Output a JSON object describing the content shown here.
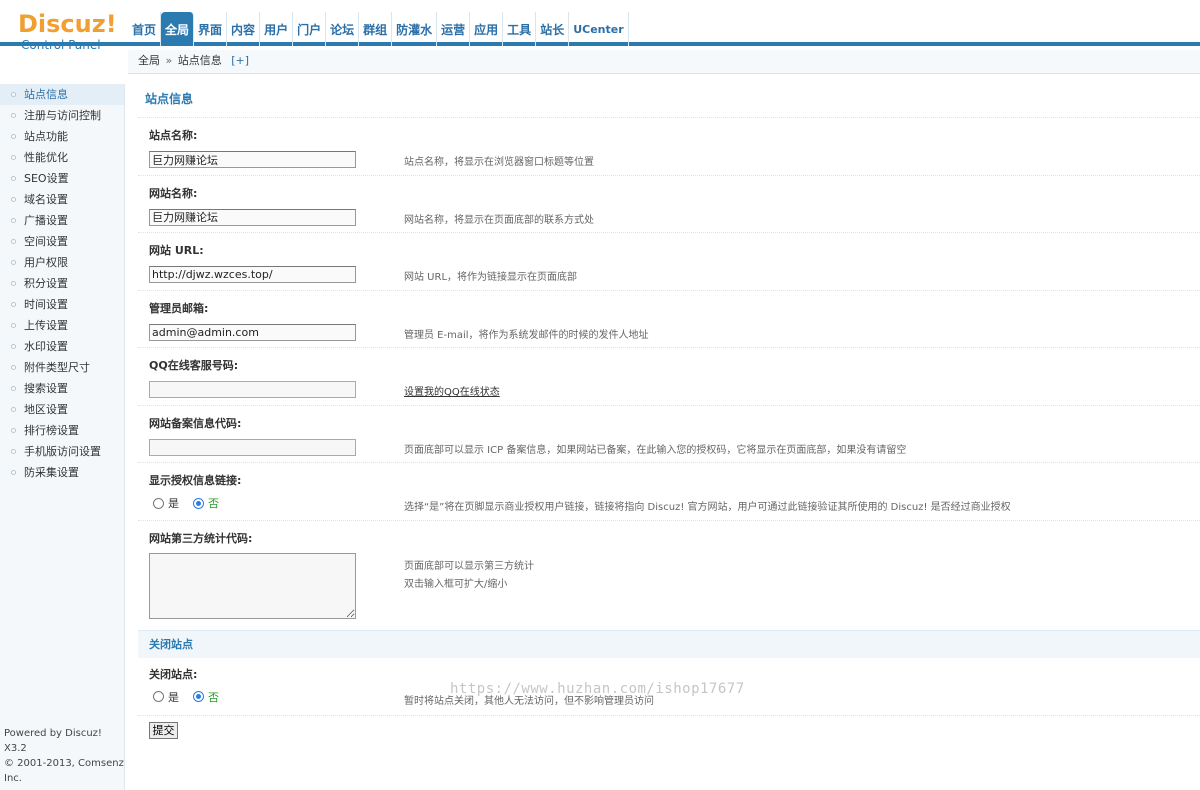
{
  "logo": {
    "main": "Discuz!",
    "sub": "Control Panel"
  },
  "topnav": [
    "首页",
    "全局",
    "界面",
    "内容",
    "用户",
    "门户",
    "论坛",
    "群组",
    "防灌水",
    "运营",
    "应用",
    "工具",
    "站长",
    "UCenter"
  ],
  "topnav_active": "全局",
  "breadcrumb": {
    "root": "全局",
    "sep": "»",
    "current": "站点信息",
    "plus": "[+]"
  },
  "sidebar": {
    "items": [
      "站点信息",
      "注册与访问控制",
      "站点功能",
      "性能优化",
      "SEO设置",
      "域名设置",
      "广播设置",
      "空间设置",
      "用户权限",
      "积分设置",
      "时间设置",
      "上传设置",
      "水印设置",
      "附件类型尺寸",
      "搜索设置",
      "地区设置",
      "排行榜设置",
      "手机版访问设置",
      "防采集设置"
    ],
    "active": "站点信息",
    "footer_line1": "Powered by Discuz! X3.2",
    "footer_line2": "© 2001-2013, Comsenz Inc."
  },
  "main": {
    "title": "站点信息",
    "fields": [
      {
        "label": "站点名称:",
        "value": "巨力网赚论坛",
        "desc": "站点名称，将显示在浏览器窗口标题等位置"
      },
      {
        "label": "网站名称:",
        "value": "巨力网赚论坛",
        "desc": "网站名称，将显示在页面底部的联系方式处"
      },
      {
        "label": "网站 URL:",
        "value": "http://djwz.wzces.top/",
        "desc": "网站 URL，将作为链接显示在页面底部"
      },
      {
        "label": "管理员邮箱:",
        "value": "admin@admin.com",
        "desc": "管理员 E-mail，将作为系统发邮件的时候的发件人地址"
      },
      {
        "label": "QQ在线客服号码:",
        "value": "",
        "desc": "设置我的QQ在线状态"
      },
      {
        "label": "网站备案信息代码:",
        "value": "",
        "desc": "页面底部可以显示 ICP 备案信息，如果网站已备案，在此输入您的授权码，它将显示在页面底部，如果没有请留空"
      }
    ],
    "license": {
      "label": "显示授权信息链接:",
      "yes": "是",
      "no": "否",
      "selected": "no",
      "desc": "选择“是”将在页脚显示商业授权用户链接，链接将指向 Discuz! 官方网站，用户可通过此链接验证其所使用的 Discuz! 是否经过商业授权"
    },
    "stats": {
      "label": "网站第三方统计代码:",
      "value": "",
      "desc1": "页面底部可以显示第三方统计",
      "desc2": "双击输入框可扩大/缩小"
    },
    "close_section": "关闭站点",
    "close": {
      "label": "关闭站点:",
      "yes": "是",
      "no": "否",
      "selected": "no",
      "desc": "暂时将站点关闭，其他人无法访问，但不影响管理员访问"
    },
    "submit": "提交"
  },
  "watermark": "https://www.huzhan.com/ishop17677"
}
